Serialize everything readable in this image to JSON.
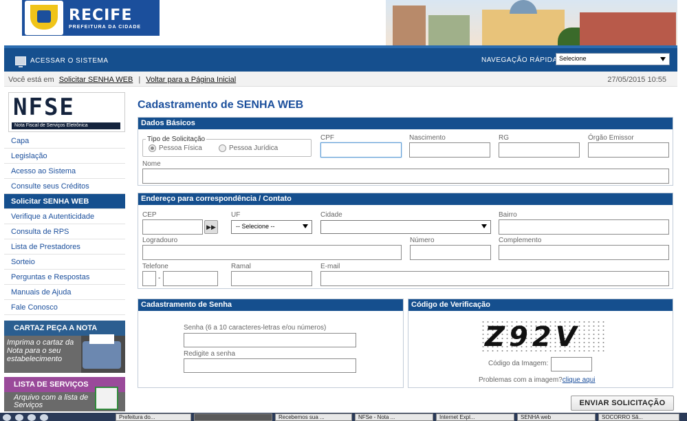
{
  "header": {
    "logo_title": "RECIFE",
    "logo_subtitle": "PREFEITURA DA CIDADE"
  },
  "nav": {
    "access_label": "ACESSAR O SISTEMA",
    "quick_label": "NAVEGAÇÃO RÁPIDA",
    "quick_select_value": "Selecione"
  },
  "breadcrumb": {
    "prefix": "Você está em",
    "current": "Solicitar SENHA WEB",
    "separator": "|",
    "back": "Voltar para a Página Inicial",
    "datetime": "27/05/2015 10:55"
  },
  "sidebar": {
    "logo_mark": "NFSE",
    "logo_sub": "Nota Fiscal de Serviços Eletrônica",
    "items": [
      {
        "label": "Capa"
      },
      {
        "label": "Legislação"
      },
      {
        "label": "Acesso ao Sistema"
      },
      {
        "label": "Consulte seus Créditos"
      },
      {
        "label": "Solicitar SENHA WEB"
      },
      {
        "label": "Verifique a Autenticidade"
      },
      {
        "label": "Consulta de RPS"
      },
      {
        "label": "Lista de Prestadores"
      },
      {
        "label": "Sorteio"
      },
      {
        "label": "Perguntas e Respostas"
      },
      {
        "label": "Manuais de Ajuda"
      },
      {
        "label": "Fale Conosco"
      }
    ],
    "promo1": {
      "title": "CARTAZ PEÇA A NOTA",
      "text": "Imprima o cartaz da Nota para o seu estabelecimento"
    },
    "promo2": {
      "title": "LISTA DE SERVIÇOS",
      "text": "Arquivo com a lista de Serviços"
    }
  },
  "main": {
    "title": "Cadastramento de SENHA WEB",
    "basic": {
      "header": "Dados Básicos",
      "tipo_legend": "Tipo de Solicitação",
      "pf": "Pessoa Física",
      "pj": "Pessoa Jurídica",
      "cpf": "CPF",
      "nascimento": "Nascimento",
      "rg": "RG",
      "orgao": "Órgão Emissor",
      "nome": "Nome"
    },
    "address": {
      "header": "Endereço para correspondência / Contato",
      "cep": "CEP",
      "uf": "UF",
      "uf_value": "-- Selecione --",
      "cidade": "Cidade",
      "bairro": "Bairro",
      "logradouro": "Logradouro",
      "numero": "Número",
      "complemento": "Complemento",
      "telefone": "Telefone",
      "ramal": "Ramal",
      "email": "E-mail"
    },
    "password": {
      "header": "Cadastramento de Senha",
      "senha": "Senha (6 a 10 caracteres-letras e/ou números)",
      "redigite": "Redigite a senha"
    },
    "verification": {
      "header": "Código de Verificação",
      "captcha_text": "Z92V",
      "codigo": "Código da Imagem:",
      "problems": "Problemas com a imagem?",
      "click_here": "clique aqui"
    },
    "submit": "ENVIAR SOLICITAÇÃO"
  },
  "taskbar": {
    "items": [
      "Prefeitura do...",
      "",
      "Recebemos sua ...",
      "NFSe - Nota ...",
      "Internet Expl...",
      "SENHA web",
      "SOCORRO Sã..."
    ]
  }
}
